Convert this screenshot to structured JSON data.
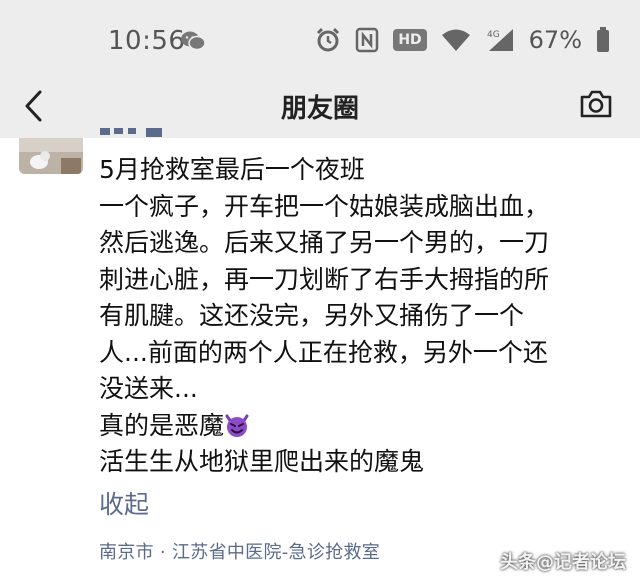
{
  "status_bar": {
    "time": "10:56",
    "hd_badge": "HD",
    "network": "4G",
    "battery": "67%"
  },
  "nav": {
    "title": "朋友圈"
  },
  "post": {
    "lines": [
      "5月抢救室最后一个夜班",
      "一个疯子，开车把一个姑娘装成脑出血，",
      "然后逃逸。后来又捅了另一个男的，一刀",
      "刺进心脏，再一刀划断了右手大拇指的所",
      "有肌腱。这还没完，另外又捅伤了一个",
      "人...前面的两个人正在抢救，另外一个还",
      "没送来...",
      "真的是恶魔",
      "活生生从地狱里爬出来的魔鬼"
    ],
    "collapse_label": "收起",
    "location": "南京市  ·  江苏省中医院-急诊抢救室"
  },
  "watermark": "头条@记者论坛",
  "icons": {
    "back": "chevron-left-icon",
    "camera": "camera-icon",
    "emoji": "smiling-devil-emoji"
  }
}
